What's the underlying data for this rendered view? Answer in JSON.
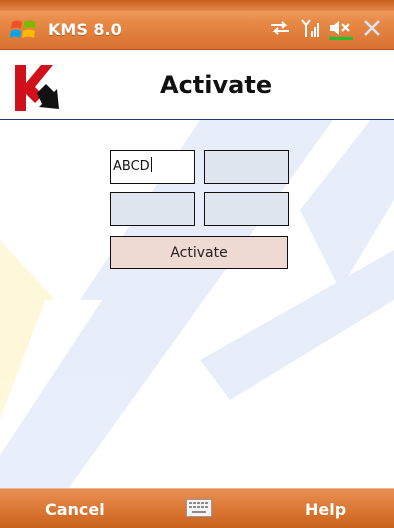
{
  "status_bar": {
    "app_title": "KMS 8.0",
    "icons": [
      "windows-logo",
      "sync-arrows-icon",
      "signal-icon",
      "volume-muted-icon",
      "close-icon"
    ]
  },
  "header": {
    "title": "Activate",
    "brand_icon": "kaspersky-logo"
  },
  "form": {
    "fields": [
      {
        "value": "ABCD",
        "active": true
      },
      {
        "value": "",
        "active": false
      },
      {
        "value": "",
        "active": false
      },
      {
        "value": "",
        "active": false
      }
    ],
    "activate_label": "Activate"
  },
  "softkeys": {
    "left": "Cancel",
    "right": "Help",
    "center_icon": "keyboard-icon"
  },
  "colors": {
    "bar_orange": "#e2803f",
    "header_line": "#1f3b78",
    "field_bg": "#dfe6ef",
    "button_bg": "#eed9d3",
    "watermark_blue": "#2a5bd7",
    "watermark_yellow": "#ffd21a"
  }
}
